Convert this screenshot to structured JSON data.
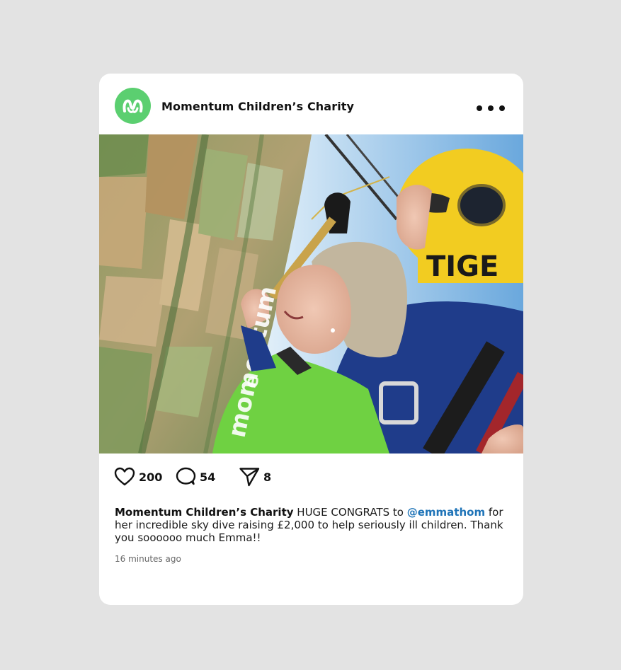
{
  "post": {
    "account_name": "Momentum Children’s Charity",
    "avatar_icon": "momentum-logo-icon",
    "more_icon": "more-options-icon",
    "photo": {
      "helmet_text": "TIGE",
      "vest_text": "momentum",
      "vest_logo_text": "e"
    },
    "actions": {
      "likes": "200",
      "comments": "54",
      "shares": "8"
    },
    "caption": {
      "author": "Momentum Children’s Charity",
      "text_before": " HUGE CONGRATS to ",
      "mention": "@emmathom",
      "text_after": " for her incredible sky dive raising £2,000 to help seriously ill children. Thank you soooooo much Emma!!"
    },
    "timestamp": "16 minutes ago"
  },
  "colors": {
    "page_background": "#e3e3e3",
    "card_background": "#ffffff",
    "brand_green": "#5bcf70",
    "mention_blue": "#1f74b8"
  }
}
